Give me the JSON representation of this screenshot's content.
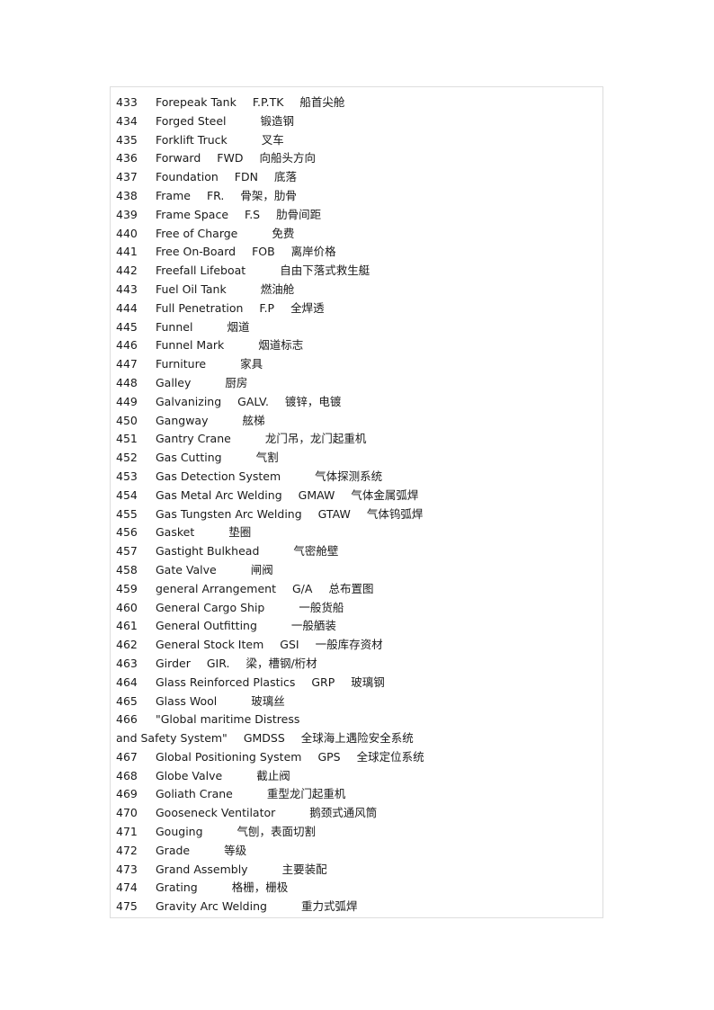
{
  "entries": [
    {
      "num": "433",
      "term": "Forepeak Tank",
      "abbr": "F.P.TK",
      "zh": "船首尖舱"
    },
    {
      "num": "434",
      "term": "Forged Steel",
      "abbr": "",
      "zh": "锻造钢"
    },
    {
      "num": "435",
      "term": "Forklift Truck",
      "abbr": "",
      "zh": "叉车"
    },
    {
      "num": "436",
      "term": "Forward",
      "abbr": "FWD",
      "zh": "向船头方向"
    },
    {
      "num": "437",
      "term": "Foundation",
      "abbr": "FDN",
      "zh": "底落"
    },
    {
      "num": "438",
      "term": "Frame",
      "abbr": "FR.",
      "zh": "骨架，肋骨"
    },
    {
      "num": "439",
      "term": "Frame Space",
      "abbr": "F.S",
      "zh": "肋骨间距"
    },
    {
      "num": "440",
      "term": "Free of Charge",
      "abbr": "",
      "zh": "免费"
    },
    {
      "num": "441",
      "term": "Free On-Board",
      "abbr": "FOB",
      "zh": "离岸价格"
    },
    {
      "num": "442",
      "term": "Freefall Lifeboat",
      "abbr": "",
      "zh": "自由下落式救生艇"
    },
    {
      "num": "443",
      "term": "Fuel Oil Tank",
      "abbr": "",
      "zh": "燃油舱"
    },
    {
      "num": "444",
      "term": "Full Penetration",
      "abbr": "F.P",
      "zh": "全焊透"
    },
    {
      "num": "445",
      "term": "Funnel",
      "abbr": "",
      "zh": "烟道"
    },
    {
      "num": "446",
      "term": "Funnel Mark",
      "abbr": "",
      "zh": "烟道标志"
    },
    {
      "num": "447",
      "term": "Furniture",
      "abbr": "",
      "zh": "家具"
    },
    {
      "num": "448",
      "term": "Galley",
      "abbr": "",
      "zh": "厨房"
    },
    {
      "num": "449",
      "term": "Galvanizing",
      "abbr": "GALV.",
      "zh": "镀锌，电镀"
    },
    {
      "num": "450",
      "term": "Gangway",
      "abbr": "",
      "zh": "舷梯"
    },
    {
      "num": "451",
      "term": "Gantry Crane",
      "abbr": "",
      "zh": "龙门吊，龙门起重机"
    },
    {
      "num": "452",
      "term": "Gas Cutting",
      "abbr": "",
      "zh": "气割"
    },
    {
      "num": "453",
      "term": "Gas Detection System",
      "abbr": "",
      "zh": "气体探测系统"
    },
    {
      "num": "454",
      "term": "Gas Metal Arc Welding",
      "abbr": "GMAW",
      "zh": "气体金属弧焊"
    },
    {
      "num": "455",
      "term": "Gas Tungsten Arc Welding",
      "abbr": "GTAW",
      "zh": "气体钨弧焊"
    },
    {
      "num": "456",
      "term": "Gasket",
      "abbr": "",
      "zh": "垫圈"
    },
    {
      "num": "457",
      "term": "Gastight Bulkhead",
      "abbr": "",
      "zh": "气密舱壁"
    },
    {
      "num": "458",
      "term": "Gate Valve",
      "abbr": "",
      "zh": "闸阀"
    },
    {
      "num": "459",
      "term": "general Arrangement",
      "abbr": "G/A",
      "zh": "总布置图"
    },
    {
      "num": "460",
      "term": "General Cargo Ship",
      "abbr": "",
      "zh": "一般货船"
    },
    {
      "num": "461",
      "term": "General Outfitting",
      "abbr": "",
      "zh": "一般舾装"
    },
    {
      "num": "462",
      "term": "General Stock Item",
      "abbr": "GSI",
      "zh": "一般库存资材"
    },
    {
      "num": "463",
      "term": "Girder",
      "abbr": "GIR.",
      "zh": "梁，槽钢/桁材"
    },
    {
      "num": "464",
      "term": "Glass Reinforced Plastics",
      "abbr": "GRP",
      "zh": "玻璃钢"
    },
    {
      "num": "465",
      "term": "Glass Wool",
      "abbr": "",
      "zh": "玻璃丝"
    },
    {
      "num": "466",
      "term": "\"Global maritime Distress",
      "abbr": "",
      "zh": ""
    },
    {
      "num": "",
      "term": "and Safety System\"",
      "abbr": "GMDSS",
      "zh": "全球海上遇险安全系统"
    },
    {
      "num": "467",
      "term": "Global Positioning System",
      "abbr": "GPS",
      "zh": "全球定位系统"
    },
    {
      "num": "468",
      "term": "Globe Valve",
      "abbr": "",
      "zh": "截止阀"
    },
    {
      "num": "469",
      "term": "Goliath Crane",
      "abbr": "",
      "zh": "重型龙门起重机"
    },
    {
      "num": "470",
      "term": "Gooseneck Ventilator",
      "abbr": "",
      "zh": "鹅颈式通风筒"
    },
    {
      "num": "471",
      "term": "Gouging",
      "abbr": "",
      "zh": "气刨，表面切割"
    },
    {
      "num": "472",
      "term": "Grade",
      "abbr": "",
      "zh": "等级"
    },
    {
      "num": "473",
      "term": "Grand Assembly",
      "abbr": "",
      "zh": "主要装配"
    },
    {
      "num": "474",
      "term": "Grating",
      "abbr": "",
      "zh": "格栅，栅极"
    },
    {
      "num": "475",
      "term": "Gravity Arc Welding",
      "abbr": "",
      "zh": "重力式弧焊"
    }
  ]
}
